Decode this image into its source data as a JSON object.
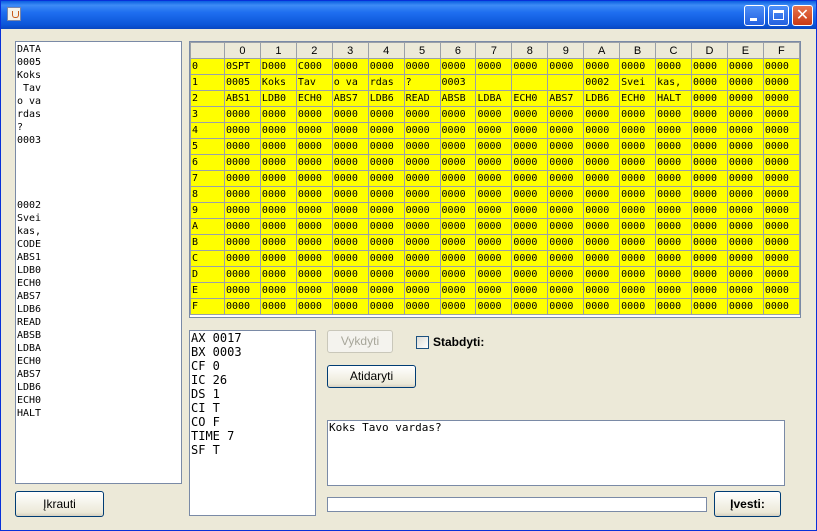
{
  "window": {
    "title": "",
    "minimize": "minimize-icon",
    "maximize": "maximize-icon",
    "close_glyph": "✕"
  },
  "source_lines": [
    "DATA",
    "0005",
    "Koks",
    " Tav",
    "o va",
    "rdas",
    "?",
    "0003",
    "",
    "",
    "",
    "",
    "0002",
    "Svei",
    "kas,",
    "CODE",
    "ABS1",
    "LDB0",
    "ECH0",
    "ABS7",
    "LDB6",
    "READ",
    "ABSB",
    "LDBA",
    "ECH0",
    "ABS7",
    "LDB6",
    "ECH0",
    "HALT"
  ],
  "memory": {
    "col_headers": [
      "",
      "0",
      "1",
      "2",
      "3",
      "4",
      "5",
      "6",
      "7",
      "8",
      "9",
      "A",
      "B",
      "C",
      "D",
      "E",
      "F"
    ],
    "rows": [
      [
        "0",
        "0SPT",
        "D000",
        "C000",
        "0000",
        "0000",
        "0000",
        "0000",
        "0000",
        "0000",
        "0000",
        "0000",
        "0000",
        "0000",
        "0000",
        "0000",
        "0000"
      ],
      [
        "1",
        "0005",
        "Koks",
        " Tav",
        "o va",
        "rdas",
        "?",
        "0003",
        "",
        "",
        "",
        "0002",
        "Svei",
        "kas,",
        "0000",
        "0000",
        "0000"
      ],
      [
        "2",
        "ABS1",
        "LDB0",
        "ECH0",
        "ABS7",
        "LDB6",
        "READ",
        "ABSB",
        "LDBA",
        "ECH0",
        "ABS7",
        "LDB6",
        "ECH0",
        "HALT",
        "0000",
        "0000",
        "0000"
      ],
      [
        "3",
        "0000",
        "0000",
        "0000",
        "0000",
        "0000",
        "0000",
        "0000",
        "0000",
        "0000",
        "0000",
        "0000",
        "0000",
        "0000",
        "0000",
        "0000",
        "0000"
      ],
      [
        "4",
        "0000",
        "0000",
        "0000",
        "0000",
        "0000",
        "0000",
        "0000",
        "0000",
        "0000",
        "0000",
        "0000",
        "0000",
        "0000",
        "0000",
        "0000",
        "0000"
      ],
      [
        "5",
        "0000",
        "0000",
        "0000",
        "0000",
        "0000",
        "0000",
        "0000",
        "0000",
        "0000",
        "0000",
        "0000",
        "0000",
        "0000",
        "0000",
        "0000",
        "0000"
      ],
      [
        "6",
        "0000",
        "0000",
        "0000",
        "0000",
        "0000",
        "0000",
        "0000",
        "0000",
        "0000",
        "0000",
        "0000",
        "0000",
        "0000",
        "0000",
        "0000",
        "0000"
      ],
      [
        "7",
        "0000",
        "0000",
        "0000",
        "0000",
        "0000",
        "0000",
        "0000",
        "0000",
        "0000",
        "0000",
        "0000",
        "0000",
        "0000",
        "0000",
        "0000",
        "0000"
      ],
      [
        "8",
        "0000",
        "0000",
        "0000",
        "0000",
        "0000",
        "0000",
        "0000",
        "0000",
        "0000",
        "0000",
        "0000",
        "0000",
        "0000",
        "0000",
        "0000",
        "0000"
      ],
      [
        "9",
        "0000",
        "0000",
        "0000",
        "0000",
        "0000",
        "0000",
        "0000",
        "0000",
        "0000",
        "0000",
        "0000",
        "0000",
        "0000",
        "0000",
        "0000",
        "0000"
      ],
      [
        "A",
        "0000",
        "0000",
        "0000",
        "0000",
        "0000",
        "0000",
        "0000",
        "0000",
        "0000",
        "0000",
        "0000",
        "0000",
        "0000",
        "0000",
        "0000",
        "0000"
      ],
      [
        "B",
        "0000",
        "0000",
        "0000",
        "0000",
        "0000",
        "0000",
        "0000",
        "0000",
        "0000",
        "0000",
        "0000",
        "0000",
        "0000",
        "0000",
        "0000",
        "0000"
      ],
      [
        "C",
        "0000",
        "0000",
        "0000",
        "0000",
        "0000",
        "0000",
        "0000",
        "0000",
        "0000",
        "0000",
        "0000",
        "0000",
        "0000",
        "0000",
        "0000",
        "0000"
      ],
      [
        "D",
        "0000",
        "0000",
        "0000",
        "0000",
        "0000",
        "0000",
        "0000",
        "0000",
        "0000",
        "0000",
        "0000",
        "0000",
        "0000",
        "0000",
        "0000",
        "0000"
      ],
      [
        "E",
        "0000",
        "0000",
        "0000",
        "0000",
        "0000",
        "0000",
        "0000",
        "0000",
        "0000",
        "0000",
        "0000",
        "0000",
        "0000",
        "0000",
        "0000",
        "0000"
      ],
      [
        "F",
        "0000",
        "0000",
        "0000",
        "0000",
        "0000",
        "0000",
        "0000",
        "0000",
        "0000",
        "0000",
        "0000",
        "0000",
        "0000",
        "0000",
        "0000",
        "0000"
      ]
    ]
  },
  "registers": [
    "AX 0017",
    "BX 0003",
    "CF 0",
    "IC 26",
    "DS 1",
    "CI T",
    "CO F",
    "TIME 7",
    "SF T"
  ],
  "buttons": {
    "execute": "Vykdyti",
    "open": "Atidaryti",
    "load": "Įkrauti",
    "enter": "Įvesti:"
  },
  "stop": {
    "label": "Stabdyti:",
    "checked": false
  },
  "output_text": "Koks Tavo vardas?",
  "input_value": "",
  "colors": {
    "memory_fill": "#ffff00",
    "titlebar": "#0b55d8"
  }
}
